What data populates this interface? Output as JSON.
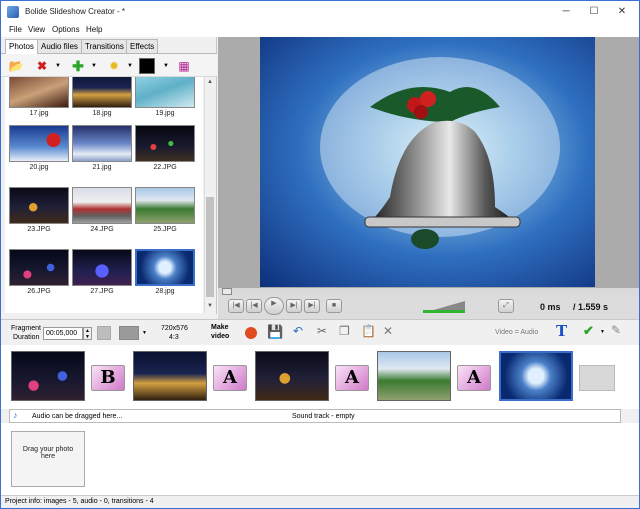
{
  "window": {
    "title": "Bolide Slideshow Creator - *",
    "minimize": "─",
    "maximize": "☐",
    "close": "✕"
  },
  "menu": [
    "File",
    "View",
    "Options",
    "Help"
  ],
  "tabs": [
    "Photos",
    "Audio files",
    "Transitions",
    "Effects"
  ],
  "thumbnails": [
    "17.jpg",
    "18.jpg",
    "19.jpg",
    "20.jpg",
    "21.jpg",
    "22.JPG",
    "23.JPG",
    "24.JPG",
    "25.JPG",
    "26.JPG",
    "27.JPG",
    "28.jpg"
  ],
  "player": {
    "current_time": "0 ms",
    "total_time": "/ 1.559 s"
  },
  "controls": {
    "fragment_label_1": "Fragment",
    "fragment_label_2": "Duration",
    "duration_value": "00:05,000",
    "resolution_1": "720x576",
    "resolution_2": "4:3",
    "make_video_1": "Make",
    "make_video_2": "video",
    "video_audio": "Video = Audio"
  },
  "timeline": {
    "transition_b": "B",
    "transition_a": "A"
  },
  "audio": {
    "hint": "Audio can be dragged here...",
    "soundtrack": "Sound track - empty"
  },
  "dropzone": {
    "line1": "Drag your photo",
    "line2": "here"
  },
  "status": "Project info: images - 5, audio - 0, transitions - 4",
  "colors": {
    "accent": "#3a6ec8",
    "window_frame": "#3b6fd6"
  }
}
